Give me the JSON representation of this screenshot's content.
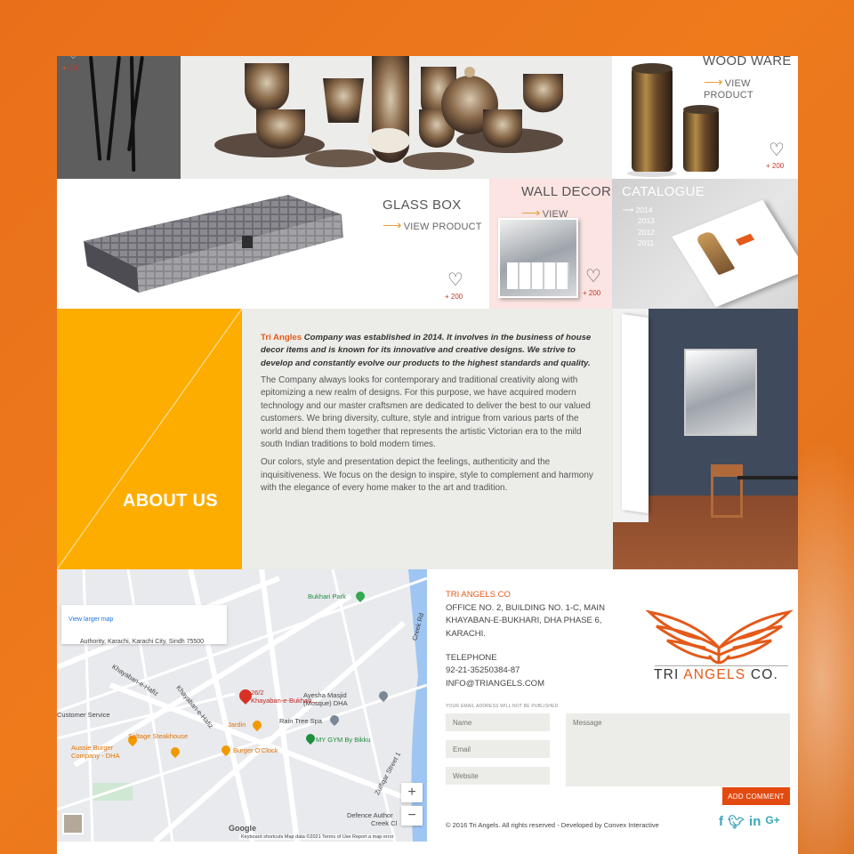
{
  "products": {
    "legs": {
      "likes": "200"
    },
    "wood_ware": {
      "title": "WOOD WARE",
      "view": "VIEW PRODUCT",
      "likes": "200"
    },
    "glass_box": {
      "title": "GLASS BOX",
      "view": "VIEW PRODUCT",
      "likes": "200"
    },
    "wall_decor": {
      "title": "WALL DECOR",
      "view": "VIEW PRODUCT",
      "likes": "200"
    },
    "catalogue": {
      "title": "CATALOGUE",
      "years": [
        "2014",
        "2013",
        "2012",
        "2011"
      ]
    }
  },
  "about": {
    "title": "ABOUT US",
    "brand": "Tri Angles",
    "intro": " Company was established in 2014. It involves in the business of house decor items and is known for its innovative and creative designs. We strive to develop and constantly evolve our products to the highest standards and quality.",
    "para1": "The Company always looks for contemporary and traditional creativity along with epitomizing a new realm of designs. For this purpose, we have acquired modern technology and our master craftsmen are dedicated to deliver the best to our valued customers. We bring diversity, culture, style and intrigue from various parts of the world and blend them together that represents the artistic Victorian era to the mild south Indian traditions to bold modern times.",
    "para2": "Our colors, style and presentation depict the feelings, authenticity and the inquisitiveness. We focus on the design to inspire, style to complement and harmony with the elegance of every home maker to the art and tradition."
  },
  "map": {
    "info_address": "Authority, Karachi, Karachi City, Sindh 75500",
    "view_larger": "View larger map",
    "pin_label_1": "26/2",
    "pin_label_2": "Khayaban-e-Bukhari...",
    "places": {
      "bukhari_park": "Bukhari Park",
      "ayesha": "Ayesha Masjid",
      "ayesha_2": "(Mosque) DHA",
      "rain_tree": "Rain Tree Spa",
      "jardin": "Jardin",
      "mygym": "MY GYM By Bikku",
      "saltage": "Saltage Steakhouse",
      "aussie": "Aussie Burger",
      "aussie_2": "Company - DHA",
      "burger_oclock": "Burger O'Clock",
      "customer_service": "Customer Service",
      "defence": "Defence Author",
      "creek_club": "Creek Cl",
      "khayaban_hafiz": "Khayaban-e-Hafiz",
      "khayaban_hafiz_2": "Khayaban-e-Hafiz",
      "zulfiqar": "Zulfiqar Street 1",
      "creek_rd": "Creek Rd"
    },
    "zoom_in": "+",
    "zoom_out": "−",
    "google": "Google",
    "footer": "Keyboard shortcuts   Map data ©2021   Terms of Use   Report a map error"
  },
  "contact": {
    "company": "TRI ANGELS CO",
    "address_1": "OFFICE NO. 2, BUILDING NO. 1-C, MAIN",
    "address_2": "KHAYABAN-E-BUKHARI, DHA PHASE 6,",
    "address_3": "KARACHI.",
    "telephone_label": "TELEPHONE",
    "telephone": "92-21-35250384-87",
    "email": "INFO@TRIANGELS.COM",
    "logo_text_1": "TRI ",
    "logo_text_2": "ANGELS",
    "logo_text_3": " CO."
  },
  "form": {
    "note": "YOUR EMAIL ADDRESS WILL NOT BE PUBLISHED",
    "name_placeholder": "Name",
    "email_placeholder": "Email",
    "website_placeholder": "Website",
    "message_placeholder": "Message",
    "submit": "ADD COMMENT"
  },
  "footer": {
    "copyright": "© 2016 Tri Angels. All rights reserved - Developed by Convex Interactive"
  },
  "colors": {
    "orange": "#e8701a",
    "accent": "#e35a1a",
    "about_bg": "#fdad00",
    "social": "#3aa6b9"
  }
}
